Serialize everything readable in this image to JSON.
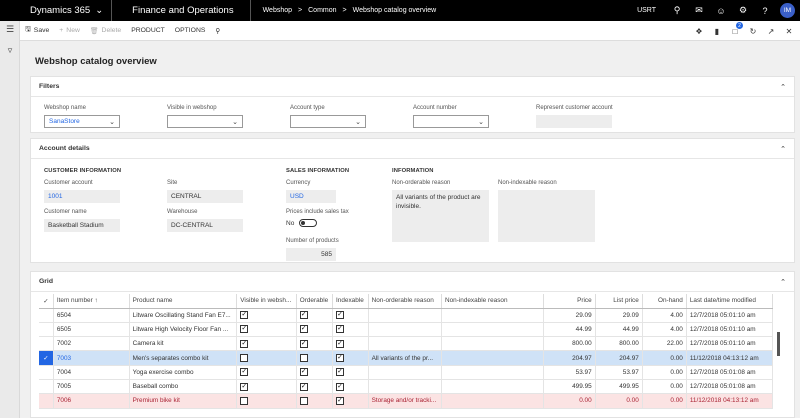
{
  "topbar": {
    "app_name": "Dynamics 365",
    "module": "Finance and Operations",
    "breadcrumbs": [
      "Webshop",
      "Common",
      "Webshop catalog overview"
    ],
    "company": "USRT",
    "user_initials": "IM"
  },
  "action_pane": {
    "save": "Save",
    "new": "New",
    "delete": "Delete",
    "product": "PRODUCT",
    "options": "OPTIONS",
    "notification_count": "2"
  },
  "page_title": "Webshop catalog overview",
  "filters": {
    "title": "Filters",
    "webshop_name": {
      "label": "Webshop name",
      "value": "SanaStore"
    },
    "visible_in_webshop": {
      "label": "Visible in webshop",
      "value": ""
    },
    "account_type": {
      "label": "Account type",
      "value": ""
    },
    "account_number": {
      "label": "Account number",
      "value": ""
    },
    "represent_customer": {
      "label": "Represent customer account",
      "value": ""
    }
  },
  "account_details": {
    "title": "Account details",
    "customer_info_header": "CUSTOMER INFORMATION",
    "customer_account": {
      "label": "Customer account",
      "value": "1001"
    },
    "customer_name": {
      "label": "Customer name",
      "value": "Basketball Stadium"
    },
    "site": {
      "label": "Site",
      "value": "CENTRAL"
    },
    "warehouse": {
      "label": "Warehouse",
      "value": "DC-CENTRAL"
    },
    "sales_info_header": "SALES INFORMATION",
    "currency": {
      "label": "Currency",
      "value": "USD"
    },
    "prices_incl_tax": {
      "label": "Prices include sales tax",
      "value": "No"
    },
    "number_of_products": {
      "label": "Number of products",
      "value": "585"
    },
    "information_header": "INFORMATION",
    "non_orderable_reason": {
      "label": "Non-orderable reason",
      "value": "All variants of the product are invisible."
    },
    "non_indexable_reason": {
      "label": "Non-indexable reason",
      "value": ""
    }
  },
  "grid": {
    "title": "Grid",
    "columns": [
      "Item number",
      "Product name",
      "Visible in websh...",
      "Orderable",
      "Indexable",
      "Non-orderable reason",
      "Non-indexable reason",
      "Price",
      "List price",
      "On-hand",
      "Last date/time modified"
    ],
    "rows": [
      {
        "item": "6504",
        "name": "Litware Oscillating Stand Fan E7...",
        "visible": true,
        "orderable": true,
        "indexable": true,
        "non_orderable": "",
        "non_indexable": "",
        "price": "29.09",
        "list_price": "29.09",
        "onhand": "4.00",
        "modified": "12/7/2018 05:01:10 am"
      },
      {
        "item": "6505",
        "name": "Litware High Velocity Floor Fan ...",
        "visible": true,
        "orderable": true,
        "indexable": true,
        "non_orderable": "",
        "non_indexable": "",
        "price": "44.99",
        "list_price": "44.99",
        "onhand": "4.00",
        "modified": "12/7/2018 05:01:10 am"
      },
      {
        "item": "7002",
        "name": "Camera kit",
        "visible": true,
        "orderable": true,
        "indexable": true,
        "non_orderable": "",
        "non_indexable": "",
        "price": "800.00",
        "list_price": "800.00",
        "onhand": "22.00",
        "modified": "12/7/2018 05:01:10 am"
      },
      {
        "item": "7003",
        "name": "Men's separates combo kit",
        "visible": false,
        "orderable": false,
        "indexable": true,
        "non_orderable": "All variants of the pr...",
        "non_indexable": "",
        "price": "204.97",
        "list_price": "204.97",
        "onhand": "0.00",
        "modified": "11/12/2018 04:13:12 am"
      },
      {
        "item": "7004",
        "name": "Yoga exercise combo",
        "visible": true,
        "orderable": true,
        "indexable": true,
        "non_orderable": "",
        "non_indexable": "",
        "price": "53.97",
        "list_price": "53.97",
        "onhand": "0.00",
        "modified": "12/7/2018 05:01:08 am"
      },
      {
        "item": "7005",
        "name": "Baseball combo",
        "visible": true,
        "orderable": true,
        "indexable": true,
        "non_orderable": "",
        "non_indexable": "",
        "price": "499.95",
        "list_price": "499.95",
        "onhand": "0.00",
        "modified": "12/7/2018 05:01:08 am"
      },
      {
        "item": "7006",
        "name": "Premium bike kit",
        "visible": false,
        "orderable": false,
        "indexable": true,
        "non_orderable": "Storage and/or tracki...",
        "non_indexable": "",
        "price": "0.00",
        "list_price": "0.00",
        "onhand": "0.00",
        "modified": "11/12/2018 04:13:12 am"
      }
    ]
  },
  "colors": {
    "accent": "#2266e3",
    "selected_row": "#cfe2f7",
    "warning_row": "#fbe3e3"
  }
}
